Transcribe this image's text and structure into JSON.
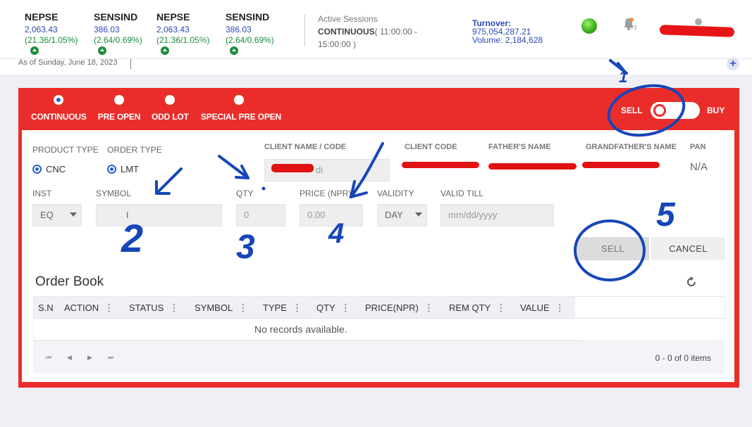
{
  "ticker": [
    {
      "name": "NEPSE",
      "value": "2,063.43",
      "change": "(21.36/1.05%)"
    },
    {
      "name": "SENSIND",
      "value": "386.03",
      "change": "(2.64/0.69%)"
    },
    {
      "name": "NEPSE",
      "value": "2,063.43",
      "change": "(21.36/1.05%)"
    },
    {
      "name": "SENSIND",
      "value": "386.03",
      "change": "(2.64/0.69%)"
    }
  ],
  "sessions": {
    "label": "Active Sessions",
    "mode": "CONTINUOUS",
    "time": "( 11:00:00 - 15:00:00 )"
  },
  "turnover": {
    "label": "Turnover:",
    "value": "975,054,287.21",
    "volume_label": "Volume:",
    "volume_value": "2,184,628"
  },
  "notifications": {
    "count": "973"
  },
  "as_of": "As of Sunday, June 18, 2023",
  "market_types": [
    {
      "label": "CONTINUOUS",
      "selected": true
    },
    {
      "label": "PRE OPEN",
      "selected": false
    },
    {
      "label": "ODD LOT",
      "selected": false
    },
    {
      "label": "SPECIAL PRE OPEN",
      "selected": false
    }
  ],
  "side_toggle": {
    "sell": "SELL",
    "buy": "BUY",
    "state": "SELL"
  },
  "form": {
    "product_type": {
      "label": "PRODUCT TYPE",
      "value": "CNC"
    },
    "order_type": {
      "label": "ORDER TYPE",
      "value": "LMT"
    },
    "client_name_label": "CLIENT NAME / CODE",
    "client_name_value": "di",
    "client_code_label": "CLIENT CODE",
    "father_name_label": "FATHER'S NAME",
    "grandfather_name_label": "GRANDFATHER'S NAME",
    "pan_label": "PAN",
    "pan_value": "N/A",
    "inst_label": "INST",
    "inst_value": "EQ",
    "symbol_label": "SYMBOL",
    "qty_label": "QTY",
    "qty_value": "0",
    "price_label": "PRICE (NPR)",
    "price_value": "0.00",
    "validity_label": "VALIDITY",
    "validity_value": "DAY",
    "valid_till_label": "VALID TILL",
    "valid_till_placeholder": "mm/dd/yyyy"
  },
  "actions": {
    "sell": "SELL",
    "cancel": "CANCEL"
  },
  "order_book": {
    "title": "Order Book",
    "columns": [
      "S.N",
      "ACTION",
      "STATUS",
      "SYMBOL",
      "TYPE",
      "QTY",
      "PRICE(NPR)",
      "REM QTY",
      "VALUE"
    ],
    "empty_text": "No records available.",
    "pager_info": "0 - 0 of 0 items"
  },
  "annotations": [
    "1",
    "2",
    "3",
    "4",
    "5"
  ],
  "colors": {
    "accent_red": "#ea2d2a",
    "positive_green": "#1e8c3a",
    "link_blue": "#2a4bb7",
    "ink_blue": "#1746b8"
  }
}
